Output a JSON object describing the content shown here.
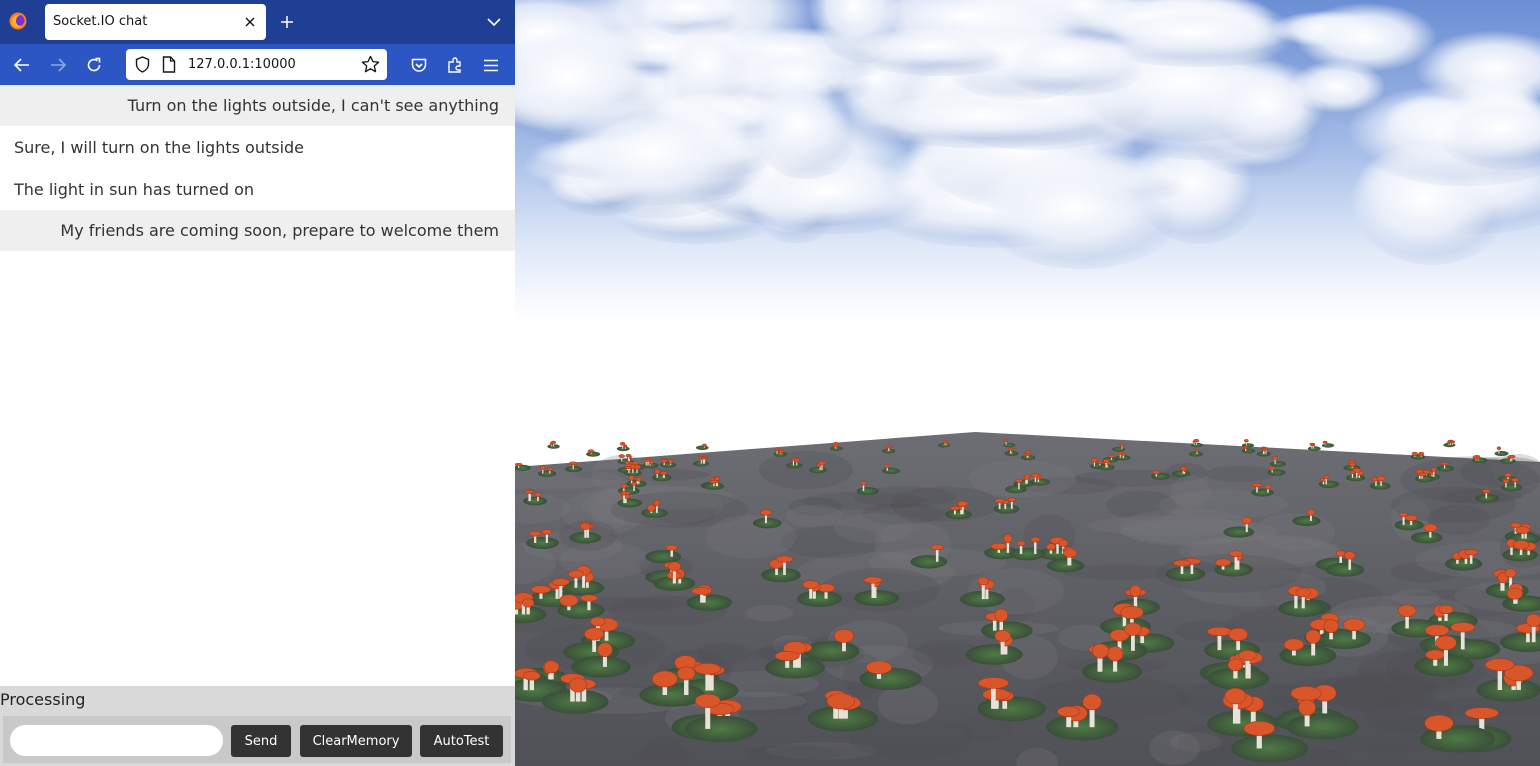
{
  "browser": {
    "tab_title": "Socket.IO chat",
    "url": "127.0.0.1:10000"
  },
  "chat": {
    "messages": [
      {
        "text": "Turn on the lights outside, I can't see anything",
        "align": "right"
      },
      {
        "text": "Sure, I will turn on the lights outside",
        "align": "left"
      },
      {
        "text": "The light in sun has turned on",
        "align": "left"
      },
      {
        "text": "My friends are coming soon, prepare to welcome them",
        "align": "right"
      }
    ],
    "status": "Processing",
    "input_value": "",
    "buttons": {
      "send": "Send",
      "clear_memory": "ClearMemory",
      "auto_test": "AutoTest"
    }
  },
  "colors": {
    "tab_bar": "#1f3f95",
    "nav_bar": "#2b56c4",
    "message_alt_bg": "#efefef",
    "button_bg": "#333333",
    "ground": "#5e5f66",
    "mushroom_cap": "#d9552a"
  },
  "scene": {
    "description_icons": [
      "firefox-logo-icon",
      "sky-clouds",
      "ground-plane",
      "mushroom-patches"
    ]
  }
}
